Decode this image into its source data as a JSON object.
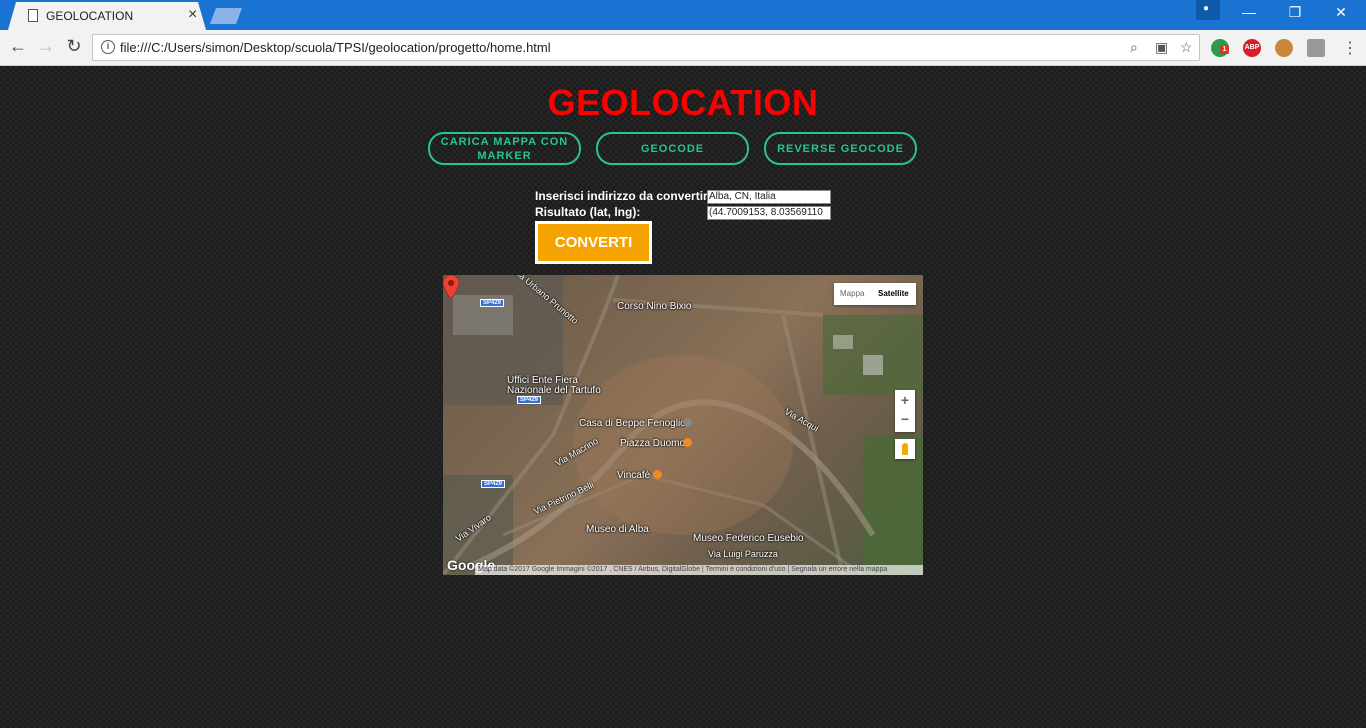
{
  "browser": {
    "tab_title": "GEOLOCATION",
    "tab_close": "×",
    "url": "file:///C:/Users/simon/Desktop/scuola/TPSI/geolocation/progetto/home.html",
    "window_controls": {
      "minimize": "—",
      "restore": "❐",
      "close": "✕"
    },
    "extensions": {
      "abp": "ABP",
      "badge": "1"
    }
  },
  "page": {
    "heading": "GEOLOCATION",
    "buttons": {
      "load_map": "CARICA MAPPA CON MARKER",
      "geocode": "GEOCODE",
      "reverse_geocode": "REVERSE GEOCODE"
    },
    "form": {
      "address_label": "Inserisci indirizzo da convertire:",
      "address_value": "Alba, CN, Italia",
      "result_label": "Risultato (lat, lng):",
      "result_value": "(44.7009153, 8.03569110",
      "convert_label": "CONVERTI"
    }
  },
  "map": {
    "type_control": {
      "map": "Mappa",
      "satellite": "Satellite",
      "selected": "Satellite"
    },
    "zoom": {
      "in": "+",
      "out": "−"
    },
    "labels": {
      "corso_nino_bixio": "Corso Nino Bixio",
      "uffici_ente_fiera": "Uffici Ente Fiera",
      "nazionale_tartufo": "Nazionale del Tartufo",
      "casa_fenoglio": "Casa di Beppe Fenoglio",
      "piazza_duomo": "Piazza Duomo",
      "vincafe": "Vincafè",
      "museo_alba": "Museo di Alba",
      "museo_eusebio": "Museo Federico Eusebio",
      "via_paruzza": "Via Luigi Paruzza",
      "via_macrino": "Via Macrino",
      "via_belli": "Via Pietrino Belli",
      "via_acqui": "Via Acqui",
      "via_vivaro": "Via Vivaro",
      "via_urbano": "Via Urbano Prunotto",
      "sp429_a": "SP429",
      "sp429_b": "SP429",
      "sp429_c": "SP429"
    },
    "google": "Google",
    "attribution": "Map data ©2017 Google Immagini ©2017 , CNES / Airbus, DigitalGlobe   |   Termini e condizioni d'uso   |   Segnala un errore nella mappa"
  },
  "colors": {
    "heading": "#ff0000",
    "button_outline": "#26c490",
    "convert_bg": "#f5a300",
    "chrome_blue": "#1a73d2"
  }
}
